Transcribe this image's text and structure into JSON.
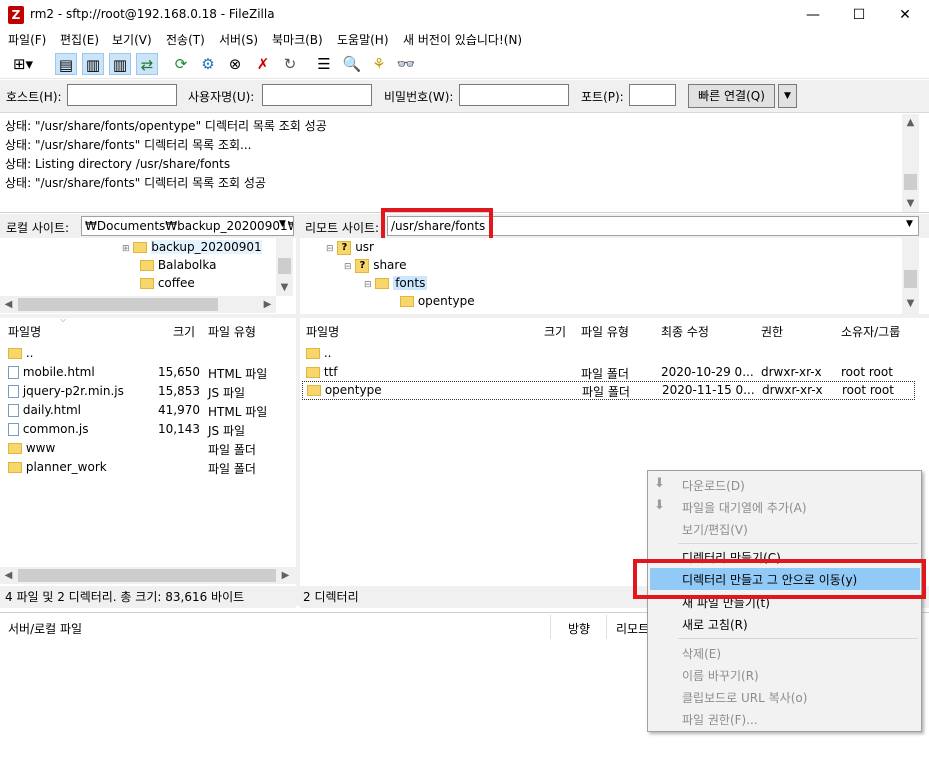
{
  "window": {
    "title": "rm2 - sftp://root@192.168.0.18 - FileZilla",
    "app_icon": "Z",
    "min": "—",
    "max": "☐",
    "close": "✕"
  },
  "menu": [
    "파일(F)",
    "편집(E)",
    "보기(V)",
    "전송(T)",
    "서버(S)",
    "북마크(B)",
    "도움말(H)",
    "새 버전이 있습니다!(N)"
  ],
  "quickconnect": {
    "host_label": "호스트(H):",
    "user_label": "사용자명(U):",
    "pass_label": "비밀번호(W):",
    "port_label": "포트(P):",
    "connect_button": "빠른 연결(Q)",
    "host_value": "",
    "user_value": "",
    "pass_value": "",
    "port_value": ""
  },
  "log": [
    "상태:  \"/usr/share/fonts/opentype\" 디렉터리 목록 조회 성공",
    "상태:  \"/usr/share/fonts\" 디렉터리 목록 조회...",
    "상태:  Listing directory /usr/share/fonts",
    "상태:  \"/usr/share/fonts\" 디렉터리 목록 조회 성공"
  ],
  "local": {
    "site_label": "로컬 사이트:",
    "path": "₩Documents₩backup_20200901₩",
    "tree": [
      "backup_20200901",
      "Balabolka",
      "coffee"
    ],
    "columns": [
      "파일명",
      "크기",
      "파일 유형"
    ],
    "files": [
      {
        "name": "..",
        "size": "",
        "type": ""
      },
      {
        "name": "mobile.html",
        "size": "15,650",
        "type": "HTML 파일"
      },
      {
        "name": "jquery-p2r.min.js",
        "size": "15,853",
        "type": "JS 파일"
      },
      {
        "name": "daily.html",
        "size": "41,970",
        "type": "HTML 파일"
      },
      {
        "name": "common.js",
        "size": "10,143",
        "type": "JS 파일"
      },
      {
        "name": "www",
        "size": "",
        "type": "파일 폴더"
      },
      {
        "name": "planner_work",
        "size": "",
        "type": "파일 폴더"
      }
    ],
    "status": "4 파일 및 2 디렉터리. 총 크기: 83,616 바이트"
  },
  "remote": {
    "site_label": "리모트 사이트:",
    "path": "/usr/share/fonts",
    "tree": [
      "usr",
      "share",
      "fonts",
      "opentype"
    ],
    "columns": [
      "파일명",
      "크기",
      "파일 유형",
      "최종 수정",
      "권한",
      "소유자/그룹"
    ],
    "files": [
      {
        "name": "..",
        "size": "",
        "type": "",
        "modified": "",
        "perm": "",
        "owner": ""
      },
      {
        "name": "ttf",
        "size": "",
        "type": "파일 폴더",
        "modified": "2020-10-29 0...",
        "perm": "drwxr-xr-x",
        "owner": "root root"
      },
      {
        "name": "opentype",
        "size": "",
        "type": "파일 폴더",
        "modified": "2020-11-15 0...",
        "perm": "drwxr-xr-x",
        "owner": "root root"
      }
    ],
    "status": "2 디렉터리"
  },
  "queue": {
    "columns": [
      "서버/로컬 파일",
      "방향",
      "리모트"
    ]
  },
  "context_menu": {
    "items": [
      {
        "label": "다운로드(D)",
        "disabled": true
      },
      {
        "label": "파일을 대기열에 추가(A)",
        "disabled": true
      },
      {
        "label": "보기/편집(V)",
        "disabled": true
      },
      {
        "label": "디렉터리 만들기(C)",
        "disabled": false
      },
      {
        "label": "디렉터리 만들고 그 안으로 이동(y)",
        "disabled": false,
        "highlighted": true
      },
      {
        "label": "새 파일 만들기(t)",
        "disabled": false
      },
      {
        "label": "새로 고침(R)",
        "disabled": false
      },
      {
        "label": "삭제(E)",
        "disabled": true
      },
      {
        "label": "이름 바꾸기(R)",
        "disabled": true
      },
      {
        "label": "클립보드로 URL 복사(o)",
        "disabled": true
      },
      {
        "label": "파일 권한(F)...",
        "disabled": true
      }
    ]
  },
  "colors": {
    "highlight": "#cce8ff",
    "accent_red": "#e0181e",
    "menu_selected": "#91c9f7"
  }
}
